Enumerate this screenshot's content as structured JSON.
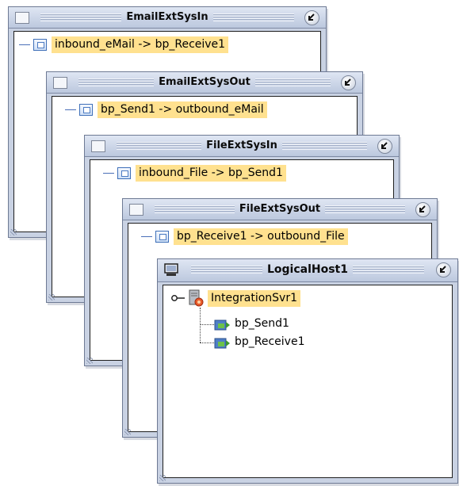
{
  "windows": [
    {
      "title": "EmailExtSysIn",
      "item": "inbound_eMail -> bp_Receive1",
      "icon": "mail-endpoint-icon"
    },
    {
      "title": "EmailExtSysOut",
      "item": "bp_Send1 -> outbound_eMail",
      "icon": "mail-endpoint-icon"
    },
    {
      "title": "FileExtSysIn",
      "item": "inbound_File -> bp_Send1",
      "icon": "file-endpoint-icon"
    },
    {
      "title": "FileExtSysOut",
      "item": "bp_Receive1 -> outbound_File",
      "icon": "file-endpoint-icon"
    }
  ],
  "host": {
    "title": "LogicalHost1",
    "server": "IntegrationSvr1",
    "children": [
      "bp_Send1",
      "bp_Receive1"
    ]
  },
  "colors": {
    "highlight": "#ffe18f",
    "titlebar": "#c4cfe3",
    "border": "#6e7a94"
  }
}
